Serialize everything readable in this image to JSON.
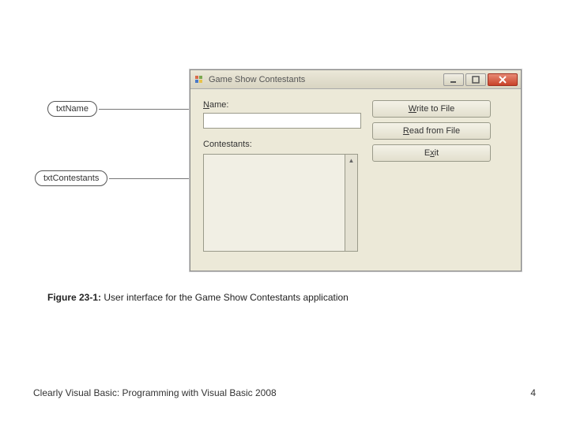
{
  "callouts": {
    "name": "txtName",
    "contestants": "txtContestants"
  },
  "window": {
    "title": "Game Show Contestants"
  },
  "form": {
    "name_label_pre": "",
    "name_label_acc": "N",
    "name_label_post": "ame:",
    "name_value": "",
    "contestants_label": "Contestants:"
  },
  "buttons": {
    "write_acc": "W",
    "write_post": "rite to File",
    "read_acc": "R",
    "read_post": "ead from File",
    "exit_pre": "E",
    "exit_acc": "x",
    "exit_post": "it"
  },
  "figure": {
    "label": "Figure 23-1:",
    "caption": "User interface for the Game Show Contestants application"
  },
  "footer": {
    "book": "Clearly Visual Basic: Programming with Visual Basic 2008",
    "page": "4"
  }
}
